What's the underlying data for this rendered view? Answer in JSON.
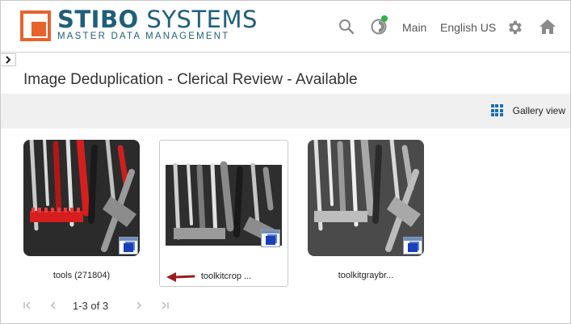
{
  "header": {
    "logo_brand_bold": "STIBO",
    "logo_brand_thin": " SYSTEMS",
    "logo_tagline": "MASTER DATA MANAGEMENT",
    "workspace": "Main",
    "language": "English US"
  },
  "page": {
    "title": "Image Deduplication - Clerical Review - Available"
  },
  "toolbar": {
    "view_label": "Gallery view"
  },
  "gallery": {
    "items": [
      {
        "caption": "tools (271804)",
        "style": "color"
      },
      {
        "caption": "toolkitcrop ...",
        "style": "gray-cropped",
        "selected": true
      },
      {
        "caption": "toolkitgraybr...",
        "style": "gray"
      }
    ]
  },
  "pager": {
    "range_text": "1-3 of 3"
  },
  "colors": {
    "brand_blue": "#1f5f7a",
    "brand_orange": "#e8632b",
    "status_green": "#2fb24a",
    "accent_blue": "#1a6fb0",
    "arrow_red": "#9b1c22"
  },
  "icons": [
    "search-icon",
    "status-icon",
    "gear-icon",
    "home-icon",
    "chevron-right-icon",
    "grid-icon",
    "image-type-icon",
    "first-page-icon",
    "prev-page-icon",
    "next-page-icon",
    "last-page-icon",
    "red-arrow-icon"
  ]
}
